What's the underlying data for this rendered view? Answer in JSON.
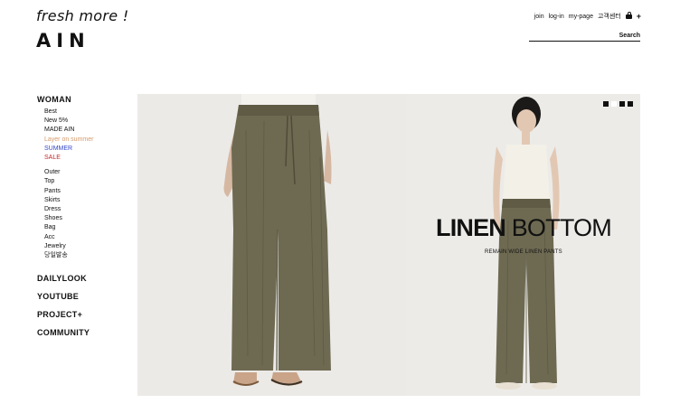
{
  "logo": {
    "tagline": "fresh more !",
    "brand": "AIN"
  },
  "topnav": {
    "join": "join",
    "login": "log-in",
    "mypage": "my-page",
    "cs": "고객센터",
    "plus": "+"
  },
  "search": {
    "label": "Search",
    "placeholder": ""
  },
  "sidebar": {
    "woman": "WOMAN",
    "featured": [
      {
        "label": "Best",
        "color": "#111111"
      },
      {
        "label": "New 5%",
        "color": "#111111"
      },
      {
        "label": "MADE AIN",
        "color": "#111111"
      },
      {
        "label": "Layer on summer",
        "color": "#d49a6a"
      },
      {
        "label": "SUMMER",
        "color": "#3346c8"
      },
      {
        "label": "SALE",
        "color": "#c62828"
      }
    ],
    "categories": [
      "Outer",
      "Top",
      "Pants",
      "Skirts",
      "Dress",
      "Shoes",
      "Bag",
      "Acc",
      "Jewelry",
      "당일발송"
    ],
    "menus": [
      "DAILYLOOK",
      "YOUTUBE",
      "PROJECT+",
      "COMMUNITY"
    ]
  },
  "hero": {
    "headline_bold": "LINEN",
    "headline_thin": " BOTTOM",
    "subline": "REMAIN WIDE LINEN PANTS",
    "slides": [
      true,
      false,
      true,
      true
    ],
    "colors": {
      "pants": "#6e6a52",
      "bg_left": "#ebeae7",
      "bg_right": "#ecebe8"
    }
  }
}
